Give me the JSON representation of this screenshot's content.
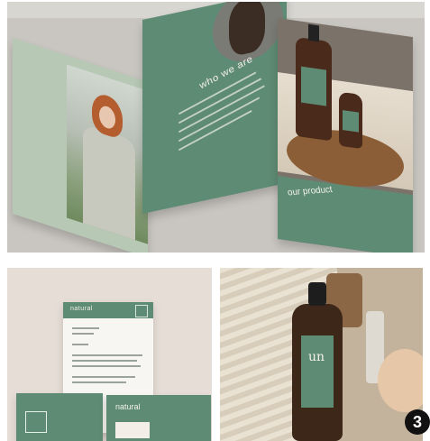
{
  "top_mockup": {
    "page2_heading": "who we are",
    "page3_heading": "our product"
  },
  "letterhead": {
    "brand": "natural"
  },
  "card": {
    "brand": "natural"
  },
  "bottle": {
    "monogram": "un"
  },
  "gallery": {
    "index_badge": "3"
  },
  "colors": {
    "brand_green": "#5e8b73",
    "bottle_brown": "#3d2719"
  }
}
